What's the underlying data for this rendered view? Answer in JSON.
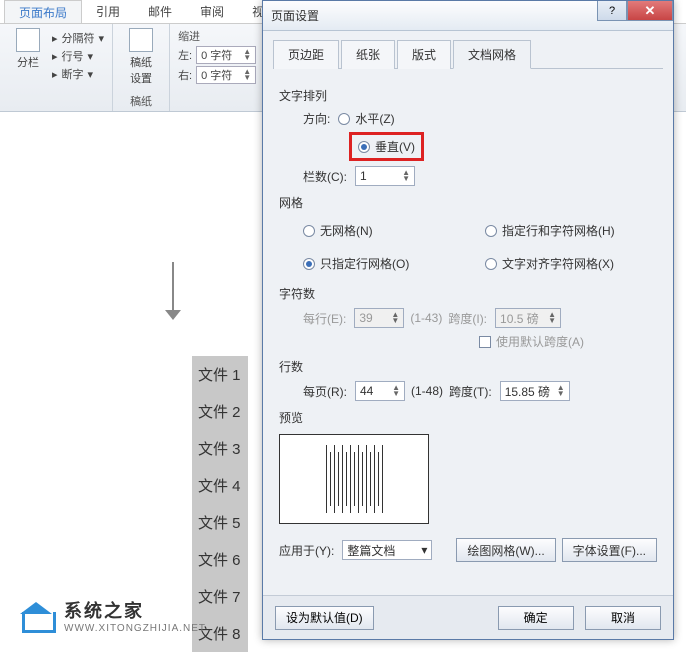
{
  "ribbon": {
    "tabs": [
      "页面布局",
      "引用",
      "邮件",
      "审阅",
      "视图"
    ],
    "active": 0,
    "group1": {
      "btn": "分栏",
      "opt1": "分隔符",
      "opt2": "行号",
      "opt3": "断字"
    },
    "group2": {
      "btn": "稿纸\n设置",
      "title": "稿纸"
    },
    "group3": {
      "title": "缩进",
      "left": "左:",
      "right": "右:",
      "val": "0 字符"
    }
  },
  "doc_items": [
    "文件 1",
    "文件 2",
    "文件 3",
    "文件 4",
    "文件 5",
    "文件 6",
    "文件 7",
    "文件 8"
  ],
  "dialog": {
    "title": "页面设置",
    "tabs": [
      "页边距",
      "纸张",
      "版式",
      "文档网格"
    ],
    "active": 3,
    "text_arrange": {
      "title": "文字排列",
      "direction": "方向:",
      "horizontal": "水平(Z)",
      "vertical": "垂直(V)",
      "columns": "栏数(C):",
      "columns_val": "1"
    },
    "grid": {
      "title": "网格",
      "none": "无网格(N)",
      "line_only": "只指定行网格(O)",
      "line_char": "指定行和字符网格(H)",
      "align": "文字对齐字符网格(X)"
    },
    "chars": {
      "title": "字符数",
      "per_line": "每行(E):",
      "per_line_val": "39",
      "range1": "(1-43)",
      "pitch": "跨度(I):",
      "pitch_val": "10.5 磅",
      "default_pitch": "使用默认跨度(A)"
    },
    "lines": {
      "title": "行数",
      "per_page": "每页(R):",
      "per_page_val": "44",
      "range": "(1-48)",
      "pitch": "跨度(T):",
      "pitch_val": "15.85 磅"
    },
    "preview": "预览",
    "apply_to": "应用于(Y):",
    "apply_val": "整篇文档",
    "btn_grid": "绘图网格(W)...",
    "btn_font": "字体设置(F)...",
    "btn_default": "设为默认值(D)",
    "btn_ok": "确定",
    "btn_cancel": "取消"
  },
  "watermark": {
    "title": "系统之家",
    "sub": "WWW.XITONGZHIJIA.NET"
  }
}
